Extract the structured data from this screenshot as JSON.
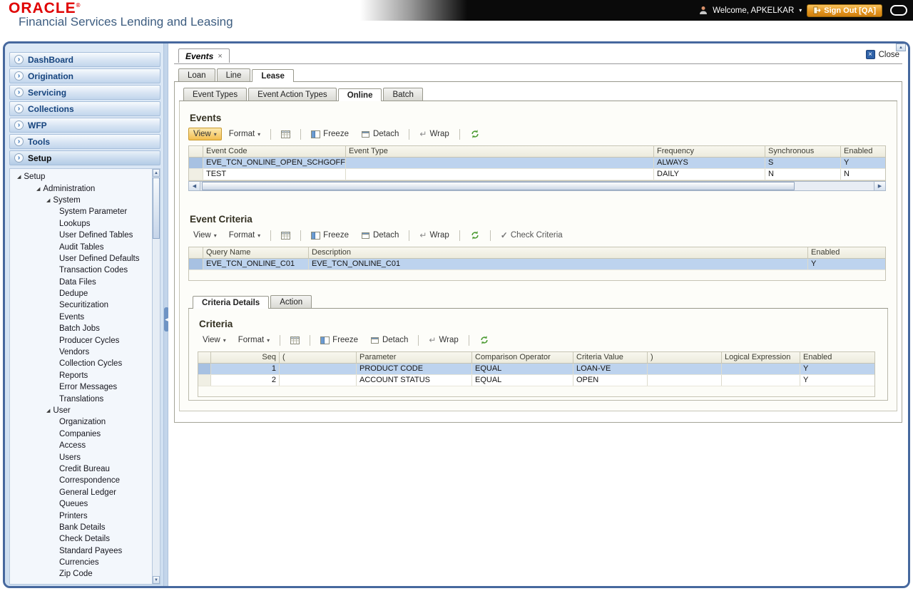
{
  "header": {
    "logo": "ORACLE",
    "logo_registered": "®",
    "subtitle": "Financial Services Lending and Leasing",
    "welcome": "Welcome, APKELKAR",
    "sign_out": "Sign Out [QA]"
  },
  "icons": {
    "caret_down": "▾",
    "accordion_chevron": "›",
    "tree_expanded": "◢",
    "close_x": "×",
    "check": "✓",
    "wrap_arrow": "↵",
    "arrow_up": "▲",
    "arrow_down": "▼",
    "arrow_left": "◀",
    "arrow_right": "▶"
  },
  "sidebar": {
    "accordion": [
      {
        "label": "DashBoard"
      },
      {
        "label": "Origination"
      },
      {
        "label": "Servicing"
      },
      {
        "label": "Collections"
      },
      {
        "label": "WFP"
      },
      {
        "label": "Tools"
      },
      {
        "label": "Setup",
        "selected": true
      }
    ],
    "tree": [
      {
        "label": "Setup",
        "level": 0,
        "expanded": true
      },
      {
        "label": "Administration",
        "level": 1,
        "expanded": true
      },
      {
        "label": "System",
        "level": 2,
        "expanded": true
      },
      {
        "label": "System Parameter",
        "level": 3
      },
      {
        "label": "Lookups",
        "level": 3
      },
      {
        "label": "User Defined Tables",
        "level": 3
      },
      {
        "label": "Audit Tables",
        "level": 3
      },
      {
        "label": "User Defined Defaults",
        "level": 3
      },
      {
        "label": "Transaction Codes",
        "level": 3
      },
      {
        "label": "Data Files",
        "level": 3
      },
      {
        "label": "Dedupe",
        "level": 3
      },
      {
        "label": "Securitization",
        "level": 3
      },
      {
        "label": "Events",
        "level": 3
      },
      {
        "label": "Batch Jobs",
        "level": 3
      },
      {
        "label": "Producer Cycles",
        "level": 3
      },
      {
        "label": "Vendors",
        "level": 3
      },
      {
        "label": "Collection Cycles",
        "level": 3
      },
      {
        "label": "Reports",
        "level": 3
      },
      {
        "label": "Error Messages",
        "level": 3
      },
      {
        "label": "Translations",
        "level": 3
      },
      {
        "label": "User",
        "level": 2,
        "expanded": true
      },
      {
        "label": "Organization",
        "level": 3
      },
      {
        "label": "Companies",
        "level": 3
      },
      {
        "label": "Access",
        "level": 3
      },
      {
        "label": "Users",
        "level": 3
      },
      {
        "label": "Credit Bureau",
        "level": 3
      },
      {
        "label": "Correspondence",
        "level": 3
      },
      {
        "label": "General Ledger",
        "level": 3
      },
      {
        "label": "Queues",
        "level": 3
      },
      {
        "label": "Printers",
        "level": 3
      },
      {
        "label": "Bank Details",
        "level": 3
      },
      {
        "label": "Check Details",
        "level": 3
      },
      {
        "label": "Standard Payees",
        "level": 3
      },
      {
        "label": "Currencies",
        "level": 3
      },
      {
        "label": "Zip Code",
        "level": 3
      }
    ]
  },
  "main": {
    "doc_tab": "Events",
    "close_label": "Close",
    "tabs_level1": [
      {
        "label": "Loan"
      },
      {
        "label": "Line"
      },
      {
        "label": "Lease",
        "active": true
      }
    ],
    "tabs_level2": [
      {
        "label": "Event Types"
      },
      {
        "label": "Event Action Types"
      },
      {
        "label": "Online",
        "active": true
      },
      {
        "label": "Batch"
      }
    ],
    "toolbar": {
      "view": "View",
      "format": "Format",
      "freeze": "Freeze",
      "detach": "Detach",
      "wrap": "Wrap",
      "check_criteria": "Check Criteria"
    },
    "events": {
      "title": "Events",
      "columns": [
        "Event Code",
        "Event Type",
        "Frequency",
        "Synchronous",
        "Enabled"
      ],
      "rows": [
        {
          "cells": [
            "EVE_TCN_ONLINE_OPEN_SCHGOFF",
            "",
            "ALWAYS",
            "S",
            "Y"
          ],
          "selected": true
        },
        {
          "cells": [
            "TEST",
            "",
            "DAILY",
            "N",
            "N"
          ]
        }
      ]
    },
    "event_criteria": {
      "title": "Event Criteria",
      "columns": [
        "Query Name",
        "Description",
        "Enabled"
      ],
      "rows": [
        {
          "cells": [
            "EVE_TCN_ONLINE_C01",
            "EVE_TCN_ONLINE_C01",
            "Y"
          ],
          "selected": true
        }
      ]
    },
    "detail_tabs": [
      {
        "label": "Criteria Details",
        "active": true
      },
      {
        "label": "Action"
      }
    ],
    "criteria": {
      "title": "Criteria",
      "columns": [
        "Seq",
        "(",
        "Parameter",
        "Comparison Operator",
        "Criteria Value",
        ")",
        "Logical Expression",
        "Enabled"
      ],
      "rows": [
        {
          "cells": [
            "1",
            "",
            "PRODUCT CODE",
            "EQUAL",
            "LOAN-VE",
            "",
            "",
            "Y"
          ],
          "selected": true
        },
        {
          "cells": [
            "2",
            "",
            "ACCOUNT STATUS",
            "EQUAL",
            "OPEN",
            "",
            "",
            "Y"
          ]
        }
      ]
    }
  }
}
